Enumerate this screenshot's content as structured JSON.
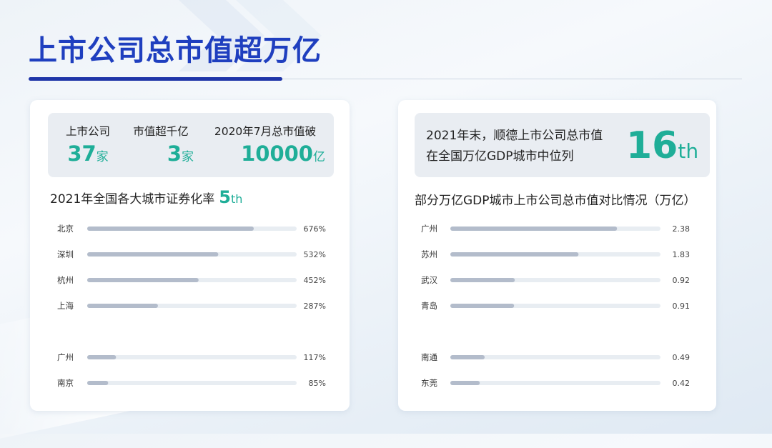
{
  "title": "上市公司总市值超万亿",
  "left_kpis": [
    {
      "label": "上市公司",
      "value": "37",
      "unit": "家"
    },
    {
      "label": "市值超千亿",
      "value": "3",
      "unit": "家"
    },
    {
      "label": "2020年7月总市值破",
      "value": "10000",
      "unit": "亿"
    }
  ],
  "right_kpi": {
    "line1": "2021年末，顺德上市公司总市值",
    "line2": "在全国万亿GDP城市中位列",
    "rank": "16",
    "suffix": "th"
  },
  "left_section": {
    "title": "2021年全国各大城市证券化率",
    "rank": "5",
    "suffix": "th"
  },
  "right_section": {
    "title": "部分万亿GDP城市上市公司总市值对比情况（万亿）"
  },
  "colors": {
    "accent": "#1fae98",
    "title": "#1f3fbf",
    "bar": "#b3bccb",
    "track": "#e8edf2"
  },
  "chart_data": [
    {
      "type": "bar",
      "title": "2021年全国各大城市证券化率",
      "categories": [
        "北京",
        "深圳",
        "杭州",
        "上海",
        "广州",
        "南京"
      ],
      "values": [
        676,
        532,
        452,
        287,
        117,
        85
      ],
      "labels": [
        "676%",
        "532%",
        "452%",
        "287%",
        "117%",
        "85%"
      ],
      "xlim": [
        0,
        850
      ]
    },
    {
      "type": "bar",
      "title": "部分万亿GDP城市上市公司总市值对比情况（万亿）",
      "categories": [
        "广州",
        "苏州",
        "武汉",
        "青岛",
        "南通",
        "东莞"
      ],
      "values": [
        2.38,
        1.83,
        0.92,
        0.91,
        0.49,
        0.42
      ],
      "labels": [
        "2.38",
        "1.83",
        "0.92",
        "0.91",
        "0.49",
        "0.42"
      ],
      "xlim": [
        0,
        3.0
      ]
    }
  ]
}
